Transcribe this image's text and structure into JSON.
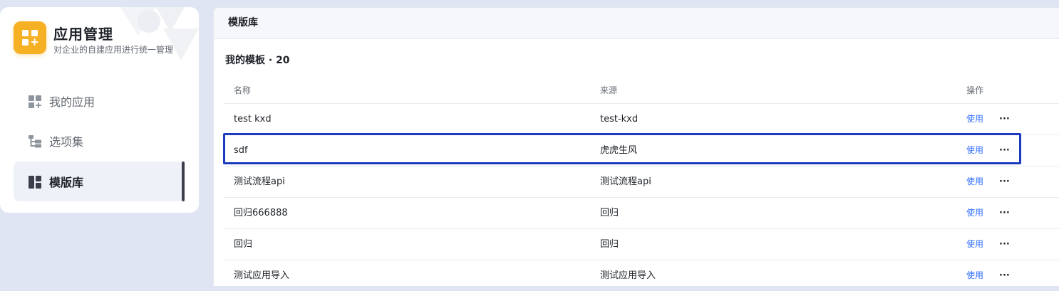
{
  "app": {
    "title": "应用管理",
    "subtitle": "对企业的自建应用进行统一管理",
    "logo_icon": "app-grid-plus-icon",
    "accent": "#f6b023"
  },
  "sidebar": {
    "items": [
      {
        "label": "我的应用",
        "icon": "apps-grid-icon",
        "active": false
      },
      {
        "label": "选项集",
        "icon": "tree-options-icon",
        "active": false
      },
      {
        "label": "模版库",
        "icon": "template-layout-icon",
        "active": true
      }
    ]
  },
  "main": {
    "header": "模版库",
    "section_title": "我的模板 · 20",
    "columns": {
      "name": "名称",
      "source": "来源",
      "actions": "操作"
    },
    "rows": [
      {
        "name": "test kxd",
        "source": "test-kxd",
        "action": "使用",
        "more": "···"
      },
      {
        "name": "sdf",
        "source": "虎虎生风",
        "action": "使用",
        "more": "···"
      },
      {
        "name": "测试流程api",
        "source": "测试流程api",
        "action": "使用",
        "more": "···"
      },
      {
        "name": "回归666888",
        "source": "回归",
        "action": "使用",
        "more": "···"
      },
      {
        "name": "回归",
        "source": "回归",
        "action": "使用",
        "more": "···"
      },
      {
        "name": "测试应用导入",
        "source": "测试应用导入",
        "action": "使用",
        "more": "···"
      }
    ],
    "highlight_color": "#1d3bbf",
    "link_color": "#3370ff"
  }
}
